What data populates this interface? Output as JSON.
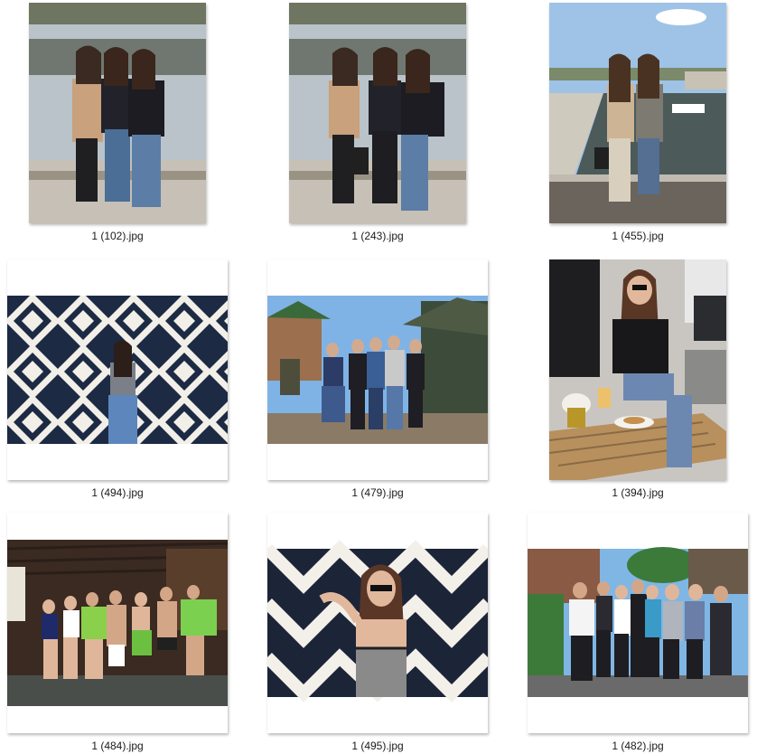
{
  "files": [
    {
      "name": "1 (102).jpg",
      "icon": "portrait-photo-icon"
    },
    {
      "name": "1 (243).jpg",
      "icon": "portrait-photo-icon"
    },
    {
      "name": "1 (455).jpg",
      "icon": "portrait-photo-icon"
    },
    {
      "name": "1 (494).jpg",
      "icon": "landscape-photo-icon"
    },
    {
      "name": "1 (479).jpg",
      "icon": "landscape-photo-icon"
    },
    {
      "name": "1 (394).jpg",
      "icon": "portrait-photo-icon"
    },
    {
      "name": "1 (484).jpg",
      "icon": "landscape-photo-icon"
    },
    {
      "name": "1 (495).jpg",
      "icon": "landscape-photo-icon"
    },
    {
      "name": "1 (482).jpg",
      "icon": "landscape-photo-icon"
    }
  ]
}
